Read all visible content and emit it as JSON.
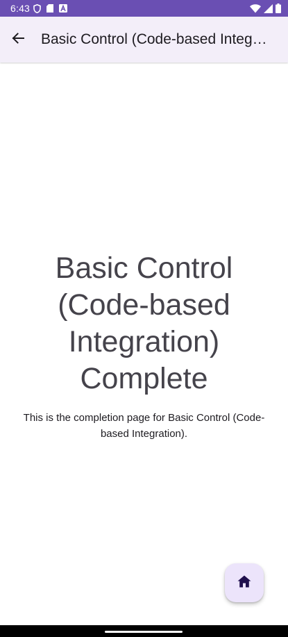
{
  "status_bar": {
    "time": "6:43",
    "left_icons": [
      "shield-icon",
      "sd-card-icon",
      "a-badge-icon"
    ],
    "right_icons": [
      "wifi-icon",
      "signal-icon",
      "battery-icon"
    ],
    "background": "#6a4fb3"
  },
  "app_bar": {
    "back_icon": "arrow-back-icon",
    "title": "Basic Control (Code-based Integration)",
    "background": "#f3eef9"
  },
  "main": {
    "headline": "Basic Control (Code-based Integration) Complete",
    "description": "This is the completion page for Basic Control (Code-based Integration)."
  },
  "fab": {
    "icon": "home-icon",
    "background": "#ece4fb",
    "icon_color": "#1f0f4d"
  }
}
